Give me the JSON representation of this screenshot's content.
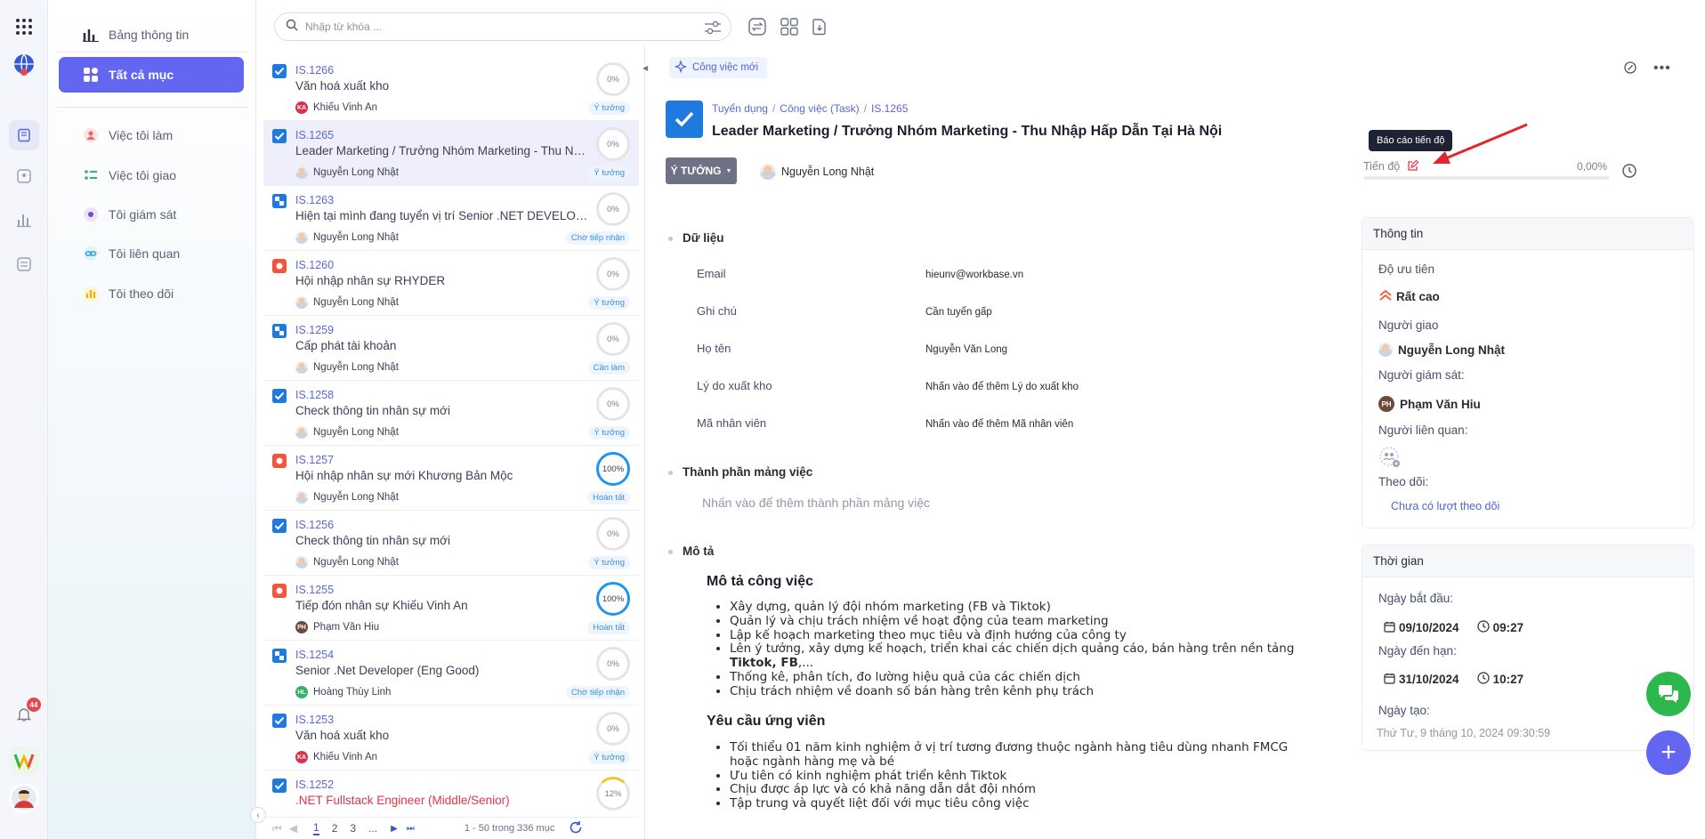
{
  "rail": {
    "notification_count": "44"
  },
  "sidebar": {
    "items": [
      {
        "label": "Bảng thông tin"
      },
      {
        "label": "Tất cả mục"
      },
      {
        "label": "Việc tôi làm"
      },
      {
        "label": "Việc tôi giao"
      },
      {
        "label": "Tôi giám sát"
      },
      {
        "label": "Tôi liên quan"
      },
      {
        "label": "Tôi theo dõi"
      }
    ]
  },
  "search": {
    "placeholder": "Nhập từ khóa ..."
  },
  "tasks": [
    {
      "id": "IS.1266",
      "title": "Văn hoá xuất kho",
      "user": "Khiếu Vinh An",
      "initials": "KA",
      "progress": "0%",
      "status": "Ý tưởng",
      "icon": "checkbox-icon"
    },
    {
      "id": "IS.1265",
      "title": "Leader Marketing / Trưởng Nhóm Marketing - Thu Nh...",
      "user": "Nguyễn Long Nhật",
      "initials": "",
      "progress": "0%",
      "status": "Ý tưởng",
      "icon": "checkbox-icon"
    },
    {
      "id": "IS.1263",
      "title": "Hiện tại mình đang tuyển vị trí Senior .NET DEVELOPE...",
      "user": "Nguyễn Long Nhật",
      "initials": "",
      "progress": "0%",
      "status": "Chờ tiếp nhận",
      "icon": "subtask-icon"
    },
    {
      "id": "IS.1260",
      "title": "Hội nhập nhân sự RHYDER",
      "user": "Nguyễn Long Nhật",
      "initials": "",
      "progress": "0%",
      "status": "Ý tưởng",
      "icon": "record-icon"
    },
    {
      "id": "IS.1259",
      "title": "Cấp phát tài khoản",
      "user": "Nguyễn Long Nhật",
      "initials": "",
      "progress": "0%",
      "status": "Cần làm",
      "icon": "subtask-icon"
    },
    {
      "id": "IS.1258",
      "title": "Check thông tin nhân sự mới",
      "user": "Nguyễn Long Nhật",
      "initials": "",
      "progress": "0%",
      "status": "Ý tưởng",
      "icon": "checkbox-icon"
    },
    {
      "id": "IS.1257",
      "title": "Hội nhập nhân sự mới Khương Bản Mộc",
      "user": "Nguyễn Long Nhật",
      "initials": "",
      "progress": "100%",
      "status": "Hoàn tất",
      "icon": "record-icon"
    },
    {
      "id": "IS.1256",
      "title": "Check thông tin nhân sự mới",
      "user": "Nguyễn Long Nhật",
      "initials": "",
      "progress": "0%",
      "status": "Ý tưởng",
      "icon": "checkbox-icon"
    },
    {
      "id": "IS.1255",
      "title": "Tiếp đón nhân sự Khiếu Vinh An",
      "user": "Phạm Văn Hiu",
      "initials": "PH",
      "progress": "100%",
      "status": "Hoàn tất",
      "icon": "record-icon"
    },
    {
      "id": "IS.1254",
      "title": "Senior .Net Developer (Eng Good)",
      "user": "Hoàng Thùy Linh",
      "initials": "HL",
      "progress": "0%",
      "status": "Chờ tiếp nhận",
      "icon": "subtask-icon"
    },
    {
      "id": "IS.1253",
      "title": "Văn hoá xuất kho",
      "user": "Khiếu Vinh An",
      "initials": "KA",
      "progress": "0%",
      "status": "Ý tưởng",
      "icon": "checkbox-icon"
    },
    {
      "id": "IS.1252",
      "title": ".NET Fullstack Engineer (Middle/Senior)",
      "user": "",
      "initials": "",
      "progress": "12%",
      "status": "",
      "icon": "checkbox-icon"
    }
  ],
  "pager": {
    "pages": [
      "1",
      "2",
      "3",
      "..."
    ],
    "summary": "1 - 50 trong 336 mục"
  },
  "detail": {
    "new_task_label": "Công việc mới",
    "breadcrumb": [
      "Tuyển dụng",
      "Công việc (Task)",
      "IS.1265"
    ],
    "title": "Leader Marketing / Trưởng Nhóm Marketing - Thu Nhập Hấp Dẫn Tại Hà Nội",
    "status": "Ý TƯỞNG",
    "owner": "Nguyễn Long Nhật",
    "progress_tooltip": "Báo cáo tiến độ",
    "progress_label": "Tiến độ",
    "progress_value": "0,00%",
    "data_section": "Dữ liệu",
    "fields": [
      {
        "label": "Email",
        "value": "hieunv@workbase.vn"
      },
      {
        "label": "Ghi chú",
        "value": "Cần tuyển gấp"
      },
      {
        "label": "Họ tên",
        "value": "Nguyễn Văn Long"
      },
      {
        "label": "Lý do xuất kho",
        "value": "Nhấn vào để thêm Lý do xuất kho"
      },
      {
        "label": "Mã nhân viên",
        "value": "Nhấn vào để thêm Mã nhân viên"
      }
    ],
    "components_section": "Thành phần mảng việc",
    "components_hint": "Nhấn vào để thêm thành phần mảng việc",
    "description_section": "Mô tả",
    "job_desc_heading": "Mô tả công việc",
    "job_desc_items": [
      "Xây dựng, quản lý đội nhóm marketing (FB và Tiktok)",
      "Quản lý và chịu trách nhiệm về hoạt động của team marketing",
      "Lập kế hoạch marketing theo mục tiêu và định hướng của công ty",
      "Lên ý tưởng, xây dựng kế hoạch, triển khai các chiến dịch quảng cáo, bán hàng trên nền tảng ",
      "Thống kê, phân tích, đo lường hiệu quả của các chiến dịch",
      "Chịu trách nhiệm về doanh số bán hàng trên kênh phụ trách"
    ],
    "job_desc_bold": "Tiktok, FB",
    "job_desc_tail": ",...",
    "req_heading": "Yêu cầu ứng viên",
    "req_items": [
      "Tối thiểu 01 năm kinh nghiệm ở vị trí tương đương thuộc ngành hàng tiêu dùng nhanh FMCG hoặc ngành hàng mẹ và bé",
      "Ưu tiên có kinh nghiệm phát triển kênh Tiktok",
      "Chịu được áp lực và có khả năng dẫn dắt đội nhóm",
      "Tập trung và quyết liệt đối với mục tiêu công việc"
    ]
  },
  "info_panel": {
    "title": "Thông tin",
    "priority_label": "Độ ưu tiên",
    "priority_value": "Rất cao",
    "assigner_label": "Người giao",
    "assigner_value": "Nguyễn Long Nhật",
    "supervisor_label": "Người giám sát:",
    "supervisor_value": "Phạm Văn Hiu",
    "supervisor_initials": "PH",
    "related_label": "Người liên quan:",
    "follow_label": "Theo dõi:",
    "follow_value": "Chưa có lượt theo dõi"
  },
  "time_panel": {
    "title": "Thời gian",
    "start_label": "Ngày bắt đầu:",
    "start_date": "09/10/2024",
    "start_time": "09:27",
    "due_label": "Ngày đến hạn:",
    "due_date": "31/10/2024",
    "due_time": "10:27",
    "created_label": "Ngày tạo:",
    "created_value": "Thứ Tư, 9 tháng 10, 2024 09:30:59"
  },
  "colors": {
    "accent": "#6366f1",
    "link": "#5b67d8",
    "task_blue": "#1f7ae0",
    "record_red": "#f4533c",
    "chat_green": "#2db84d",
    "add_purple": "#6366f1"
  }
}
